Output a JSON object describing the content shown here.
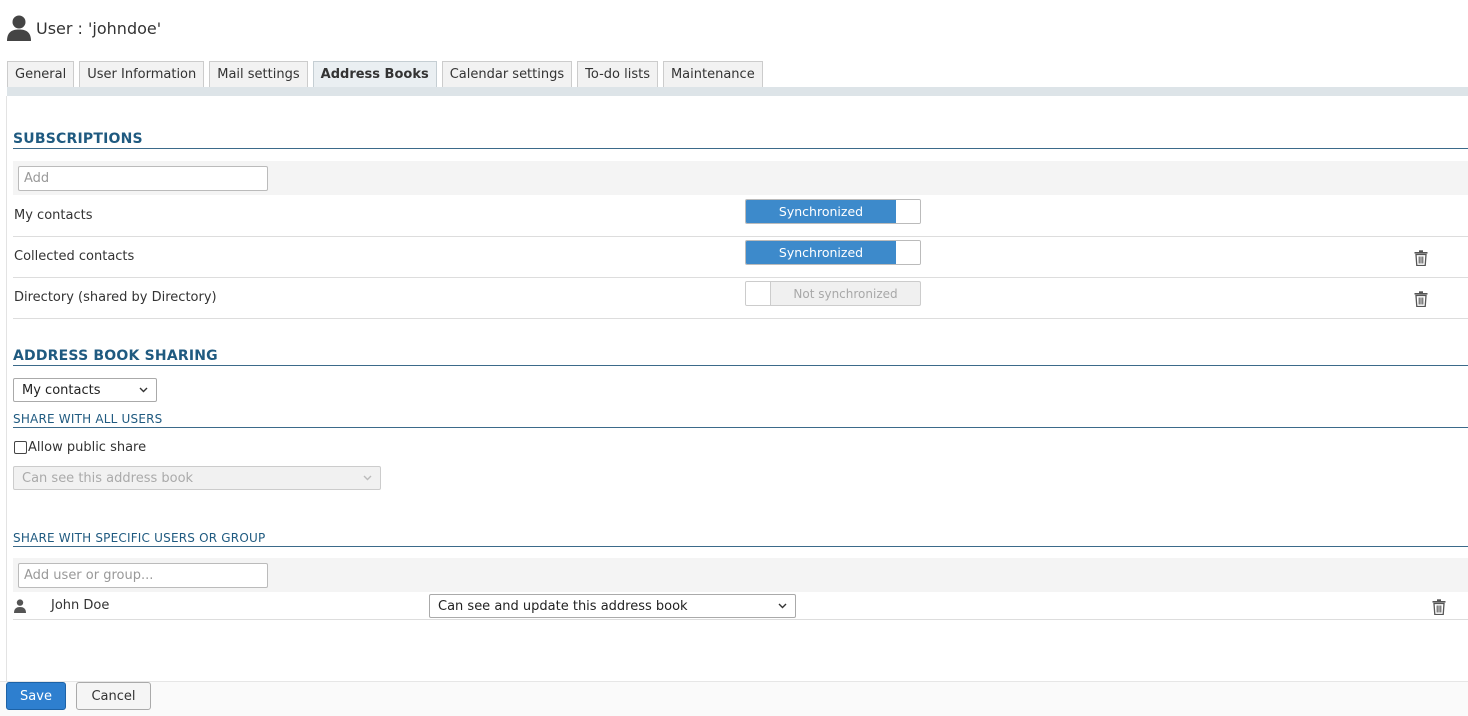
{
  "header": {
    "title": "User : 'johndoe'",
    "icon": "user-icon"
  },
  "tabs": [
    {
      "label": "General",
      "active": false
    },
    {
      "label": "User Information",
      "active": false
    },
    {
      "label": "Mail settings",
      "active": false
    },
    {
      "label": "Address Books",
      "active": true
    },
    {
      "label": "Calendar settings",
      "active": false
    },
    {
      "label": "To-do lists",
      "active": false
    },
    {
      "label": "Maintenance",
      "active": false
    }
  ],
  "subscriptions": {
    "heading": "SUBSCRIPTIONS",
    "add_placeholder": "Add",
    "rows": [
      {
        "label": "My contacts",
        "state": "Synchronized",
        "on": true,
        "deletable": false
      },
      {
        "label": "Collected contacts",
        "state": "Synchronized",
        "on": true,
        "deletable": true
      },
      {
        "label": "Directory (shared by Directory)",
        "state": "Not synchronized",
        "on": false,
        "deletable": true
      }
    ]
  },
  "sharing": {
    "heading": "ADDRESS BOOK SHARING",
    "book_select": "My contacts",
    "all_users": {
      "heading": "SHARE WITH ALL USERS",
      "public_share_label": "Allow public share",
      "public_share_checked": false,
      "rights_select": "Can see this address book"
    },
    "specific": {
      "heading": "SHARE WITH SPECIFIC USERS OR GROUP",
      "add_placeholder": "Add user or group...",
      "entries": [
        {
          "name": "John Doe",
          "rights": "Can see and update this address book"
        }
      ]
    }
  },
  "footer": {
    "save_label": "Save",
    "cancel_label": "Cancel"
  },
  "colors": {
    "accent": "#3d8acb",
    "heading": "#1f5a80",
    "primary_button": "#2e7fcf"
  }
}
